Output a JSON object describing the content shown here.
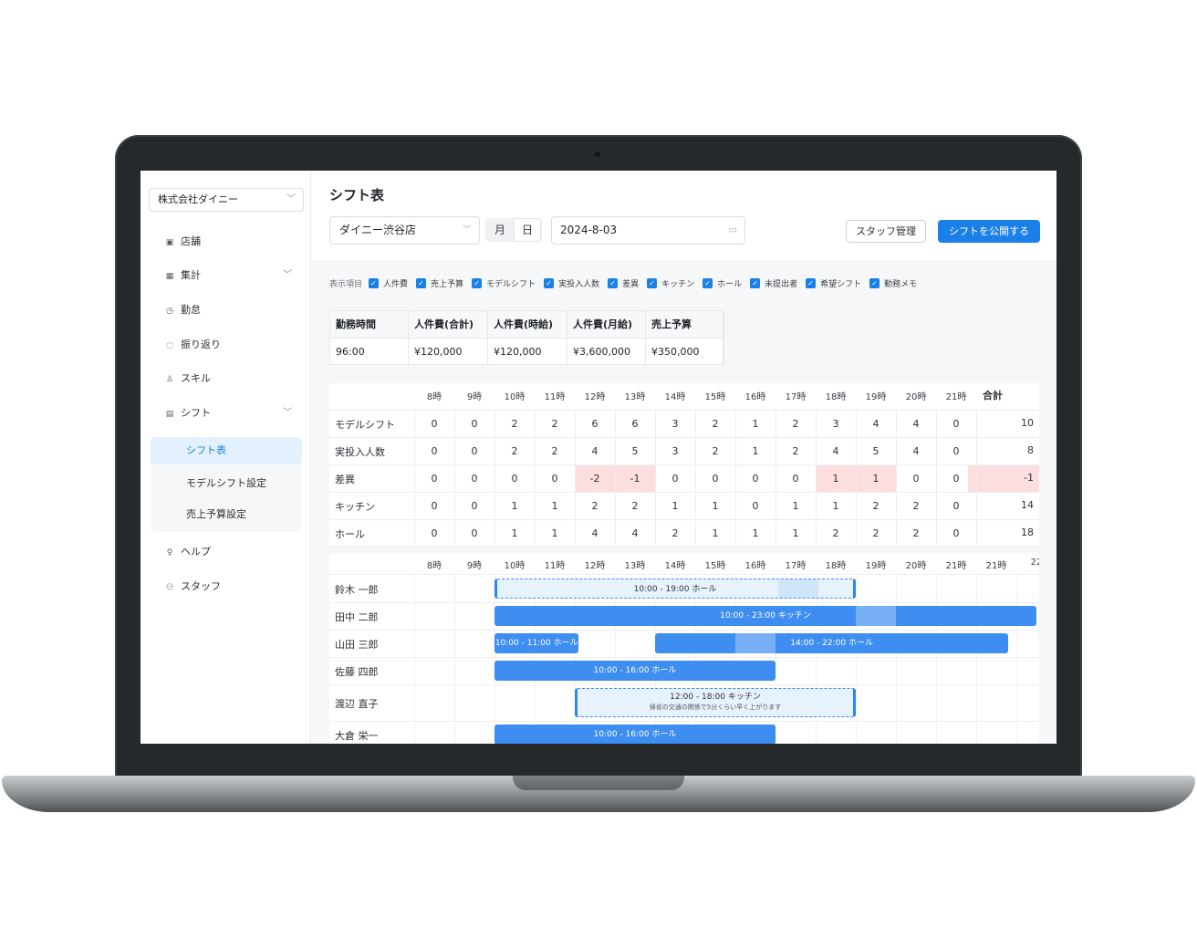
{
  "sidebar": {
    "company": "株式会社ダイニー",
    "items": [
      {
        "label": "店舗"
      },
      {
        "label": "集計"
      },
      {
        "label": "勤怠"
      },
      {
        "label": "振り返り"
      },
      {
        "label": "スキル"
      },
      {
        "label": "シフト"
      },
      {
        "label": "ヘルプ"
      },
      {
        "label": "スタッフ"
      }
    ],
    "shift_sub": [
      {
        "label": "シフト表"
      },
      {
        "label": "モデルシフト設定"
      },
      {
        "label": "売上予算設定"
      }
    ]
  },
  "header": {
    "title": "シフト表",
    "store": "ダイニー渋谷店",
    "mode_month": "月",
    "mode_day": "日",
    "date": "2024-8-03",
    "staff_button": "スタッフ管理",
    "publish_button": "シフトを公開する"
  },
  "filters": {
    "label": "表示項目",
    "items": [
      "人件費",
      "売上予算",
      "モデルシフト",
      "実投入人数",
      "差異",
      "キッチン",
      "ホール",
      "未提出者",
      "希望シフト",
      "勤務メモ"
    ]
  },
  "summary": {
    "headers": [
      "勤務時間",
      "人件費(合計)",
      "人件費(時給)",
      "人件費(月給)",
      "売上予算"
    ],
    "values": [
      "96:00",
      "¥120,000",
      "¥120,000",
      "¥3,600,000",
      "¥350,000"
    ]
  },
  "grid": {
    "hours": [
      "8時",
      "9時",
      "10時",
      "11時",
      "12時",
      "13時",
      "14時",
      "15時",
      "16時",
      "17時",
      "18時",
      "19時",
      "20時",
      "21時"
    ],
    "total_label": "合計",
    "rows": [
      {
        "label": "モデルシフト",
        "values": [
          "0",
          "0",
          "2",
          "2",
          "6",
          "6",
          "3",
          "2",
          "1",
          "2",
          "3",
          "4",
          "4",
          "0"
        ],
        "total": "10"
      },
      {
        "label": "実投入人数",
        "values": [
          "0",
          "0",
          "2",
          "2",
          "4",
          "5",
          "3",
          "2",
          "1",
          "2",
          "4",
          "5",
          "4",
          "0"
        ],
        "total": "8"
      },
      {
        "label": "差異",
        "values": [
          "0",
          "0",
          "0",
          "0",
          "-2",
          "-1",
          "0",
          "0",
          "0",
          "0",
          "1",
          "1",
          "0",
          "0"
        ],
        "total": "-1",
        "highlight": [
          4,
          5,
          10,
          11
        ],
        "total_highlight": true
      },
      {
        "label": "キッチン",
        "values": [
          "0",
          "0",
          "1",
          "1",
          "2",
          "2",
          "1",
          "1",
          "0",
          "1",
          "1",
          "2",
          "2",
          "0"
        ],
        "total": "14"
      },
      {
        "label": "ホール",
        "values": [
          "0",
          "0",
          "1",
          "1",
          "4",
          "4",
          "2",
          "1",
          "1",
          "1",
          "2",
          "2",
          "2",
          "0"
        ],
        "total": "18"
      }
    ]
  },
  "timeline": {
    "hours": [
      "8時",
      "9時",
      "10時",
      "11時",
      "12時",
      "13時",
      "14時",
      "15時",
      "16時",
      "17時",
      "18時",
      "19時",
      "20時",
      "21時",
      "21時",
      "22"
    ],
    "staff": [
      {
        "name": "鈴木 一郎",
        "shifts": [
          {
            "label": "10:00 - 19:00 ホール",
            "start": 10,
            "end": 19,
            "style": "dashed",
            "hl": [
              17,
              18
            ]
          }
        ]
      },
      {
        "name": "田中 二郎",
        "shifts": [
          {
            "label": "10:00 - 23:00 キッチン",
            "start": 10,
            "end": 23.5,
            "style": "solid",
            "hl": [
              19,
              20
            ]
          }
        ]
      },
      {
        "name": "山田 三郎",
        "shifts": [
          {
            "label": "10:00 - 11:00 ホール",
            "start": 10,
            "end": 12.1,
            "style": "solid"
          },
          {
            "label": "14:00 - 22:00 ホール",
            "start": 14,
            "end": 22.8,
            "style": "solid",
            "hl": [
              16,
              17
            ]
          }
        ]
      },
      {
        "name": "佐藤 四郎",
        "shifts": [
          {
            "label": "10:00 - 16:00 ホール",
            "start": 10,
            "end": 17,
            "style": "solid"
          }
        ]
      },
      {
        "name": "渡辺 直子",
        "shifts": [
          {
            "label": "12:00 - 18:00 キッチン",
            "note": "帰省の交通の関係で5分くらい早く上がります",
            "start": 12,
            "end": 19,
            "style": "dashed"
          }
        ]
      },
      {
        "name": "大倉 栄一",
        "shifts": [
          {
            "label": "10:00 - 16:00 ホール",
            "start": 10,
            "end": 17,
            "style": "solid"
          }
        ]
      }
    ]
  }
}
